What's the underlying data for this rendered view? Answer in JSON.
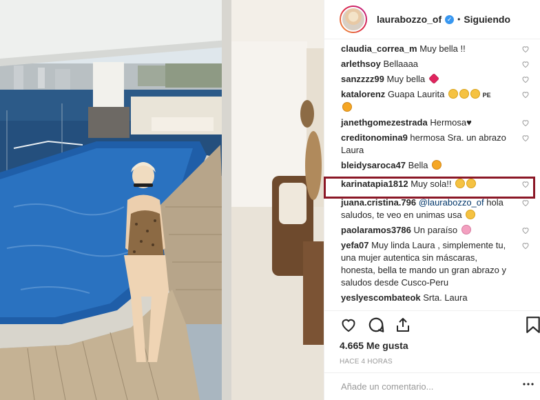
{
  "header": {
    "username": "laurabozzo_of",
    "verified": "✓",
    "separator": "•",
    "follow_status": "Siguiendo"
  },
  "comments": [
    {
      "user": "claudia_correa_m",
      "text": "Muy bella !!"
    },
    {
      "user": "arlethsoy",
      "text": "Bellaaaa"
    },
    {
      "user": "sanzzzz99",
      "text": "Muy bella"
    },
    {
      "user": "katalorenz",
      "text": "Guapa Laurita",
      "suffix": "PE"
    },
    {
      "user": "janethgomezestrada",
      "text": "Hermosa♥"
    },
    {
      "user": "creditonomina9",
      "text": "hermosa Sra. un abrazo Laura"
    },
    {
      "user": "bleidysaroca47",
      "text": "Bella"
    },
    {
      "user": "karinatapia1812",
      "text": "Muy sola!!"
    },
    {
      "user": "juana.cristina.796",
      "mention": "@laurabozzo_of",
      "text": "hola saludos, te veo en unimas usa"
    },
    {
      "user": "paolaramos3786",
      "text": "Un paraíso"
    },
    {
      "user": "yefa07",
      "text": "Muy linda Laura , simplemente tu, una mujer autentica sin máscaras, honesta, bella te mando un gran abrazo y saludos desde Cusco-Peru"
    },
    {
      "user": "yeslyescombateok",
      "text": "Srta. Laura"
    }
  ],
  "actions": {
    "likes": "4.665 Me gusta",
    "time": "HACE 4 HORAS"
  },
  "add_comment": {
    "placeholder": "Añade un comentario..."
  },
  "icons": {
    "like": "heart-icon",
    "comment": "comment-icon",
    "share": "share-icon",
    "save": "bookmark-icon"
  },
  "colors": {
    "highlight_border": "#8b1726",
    "verified_badge": "#3897f0",
    "mention": "#003569"
  }
}
